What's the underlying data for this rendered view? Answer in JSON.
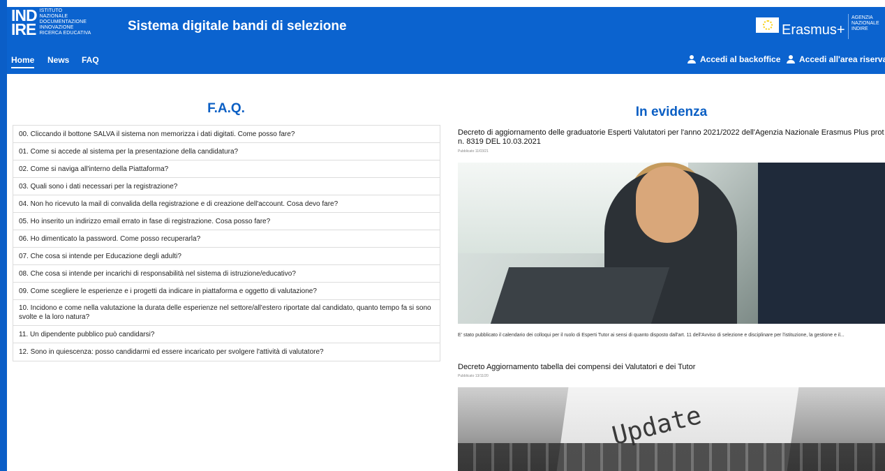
{
  "header": {
    "logo_mark": "IND\nIRE",
    "logo_lines": [
      "Istituto",
      "Nazionale",
      "Documentazione",
      "Innovazione",
      "Ricerca Educativa"
    ],
    "site_title": "Sistema digitale bandi di selezione",
    "erasmus_label": "Erasmus+",
    "agency_lines": [
      "Agenzia",
      "Nazionale",
      "Indire"
    ]
  },
  "nav": {
    "items": [
      {
        "label": "Home",
        "active": true
      },
      {
        "label": "News",
        "active": false
      },
      {
        "label": "FAQ",
        "active": false
      }
    ],
    "backoffice_label": "Accedi al backoffice",
    "reserved_label": "Accedi all'area riservata"
  },
  "faq": {
    "title": "F.A.Q.",
    "items": [
      "00. Cliccando il bottone SALVA il sistema non memorizza i dati digitati. Come posso fare?",
      "01. Come si accede al sistema per la presentazione della candidatura?",
      "02. Come si naviga all'interno della Piattaforma?",
      "03. Quali sono i dati necessari per la registrazione?",
      "04. Non ho ricevuto la mail di convalida della registrazione e di creazione dell'account. Cosa devo fare?",
      "05. Ho inserito un indirizzo email errato in fase di registrazione. Cosa posso fare?",
      "06. Ho dimenticato la password. Come posso recuperarla?",
      "07. Che cosa si intende per Educazione degli adulti?",
      "08. Che cosa si intende per incarichi di responsabilità nel sistema di istruzione/educativo?",
      "09. Come scegliere le esperienze e i progetti da indicare in piattaforma e oggetto di valutazione?",
      "10. Incidono e come nella valutazione la durata delle esperienze nel settore/all'estero riportate dal candidato, quanto tempo fa si sono svolte e la loro natura?",
      "11. Un dipendente pubblico può candidarsi?",
      "12. Sono in quiescenza: posso candidarmi ed essere incaricato per svolgere l'attività di valutatore?"
    ]
  },
  "evidenza": {
    "title": "In evidenza",
    "news": [
      {
        "title": "Decreto di aggiornamento delle graduatorie Esperti Valutatori per l'anno 2021/2022 dell'Agenzia Nazionale Erasmus Plus prot n. 8319 DEL 10.03.2021",
        "date": "Pubblicato 11/03/21",
        "excerpt": "E' stato pubblicato il calendario dei colloqui per il ruolo di Esperti Tutor ai sensi di quanto disposto dall'art. 11 dell'Avviso di selezione e disciplinare per l'istituzione, la gestione e il..."
      },
      {
        "title": "Decreto Aggiornamento tabella dei compensi dei Valutatori e dei Tutor",
        "date": "Pubblicato 13/11/20",
        "image_text": "Update"
      }
    ]
  }
}
